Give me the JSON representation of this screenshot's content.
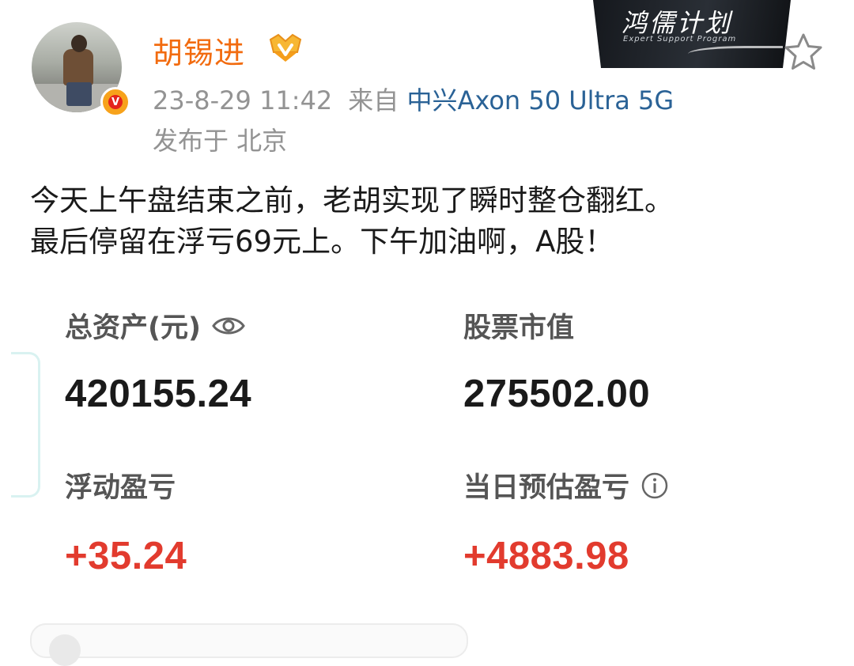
{
  "post": {
    "author": "胡锡进",
    "timestamp": "23-8-29 11:42",
    "source_prefix": "来自",
    "device": "中兴Axon 50 Ultra 5G",
    "location": "发布于 北京",
    "text_lines": [
      "今天上午盘结束之前，老胡实现了瞬时整仓翻红。",
      "最后停留在浮亏69元上。下午加油啊，A股！"
    ]
  },
  "watermark": {
    "title": "鸿儒计划",
    "subtitle": "Expert Support Program"
  },
  "account": {
    "total_assets_label": "总资产(元)",
    "total_assets_value": "420155.24",
    "stock_value_label": "股票市值",
    "stock_value_value": "275502.00",
    "floating_pnl_label": "浮动盈亏",
    "floating_pnl_value": "+35.24",
    "daily_pnl_label": "当日预估盈亏",
    "daily_pnl_value": "+4883.98"
  },
  "icons": {
    "verified_badge": "verified-v-icon",
    "member_crown": "crown-icon",
    "favorite": "star-icon",
    "visibility": "eye-icon",
    "info": "info-icon"
  },
  "colors": {
    "username": "#f26b0f",
    "device_link": "#2a6296",
    "meta_gray": "#939393",
    "positive_red": "#e23b2e"
  }
}
